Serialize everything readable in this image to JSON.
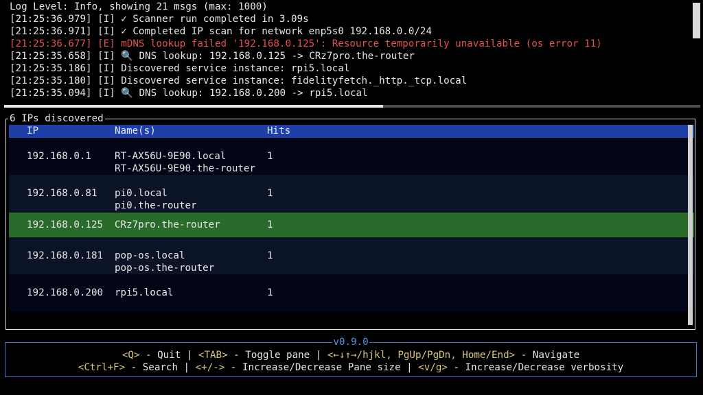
{
  "log": {
    "header": "Log Level: Info, showing 21 msgs (max: 1000)",
    "lines": [
      {
        "text": "[21:25:36.979] [I] ✓ Scanner run completed in 3.09s",
        "level": "info"
      },
      {
        "text": "[21:25:36.971] [I] ✓ Completed IP scan for network enp5s0 192.168.0.0/24",
        "level": "info"
      },
      {
        "text": "[21:25:36.677] [E] mDNS lookup failed '192.168.0.125': Resource temporarily unavailable (os error 11)",
        "level": "error"
      },
      {
        "text": "[21:25:35.658] [I] 🔍 DNS lookup: 192.168.0.125 -> CRz7pro.the-router",
        "level": "info"
      },
      {
        "text": "[21:25:35.186] [I] Discovered service instance: rpi5.local",
        "level": "info"
      },
      {
        "text": "[21:25:35.180] [I] Discovered service instance: fidelityfetch._http._tcp.local",
        "level": "info"
      },
      {
        "text": "[21:25:35.094] [I] 🔍 DNS lookup: 192.168.0.200 -> rpi5.local",
        "level": "info"
      }
    ],
    "colors": {
      "info": "#e6e6e6",
      "error": "#e0514f"
    }
  },
  "ip_table": {
    "title": "6 IPs discovered",
    "columns": {
      "ip": "IP",
      "names": "Name(s)",
      "hits": "Hits"
    },
    "rows": [
      {
        "ip": "192.168.0.1",
        "names": [
          "RT-AX56U-9E90.local",
          "RT-AX56U-9E90.the-router"
        ],
        "hits": "1",
        "selected": false
      },
      {
        "ip": "192.168.0.81",
        "names": [
          "pi0.local",
          "pi0.the-router"
        ],
        "hits": "1",
        "selected": false
      },
      {
        "ip": "192.168.0.125",
        "names": [
          "CRz7pro.the-router"
        ],
        "hits": "1",
        "selected": true
      },
      {
        "ip": "192.168.0.181",
        "names": [
          "pop-os.local",
          "pop-os.the-router"
        ],
        "hits": "1",
        "selected": false
      },
      {
        "ip": "192.168.0.200",
        "names": [
          "rpi5.local"
        ],
        "hits": "1",
        "selected": false
      }
    ],
    "colors": {
      "header_bg": "#1e3fa8",
      "selected_bg": "#2a6b2c",
      "row_a": "#020616",
      "row_b": "#0b1426"
    }
  },
  "help": {
    "version": "v0.9.0",
    "line1": [
      {
        "key": "<Q>",
        "desc": " - Quit "
      },
      {
        "sep": "| "
      },
      {
        "key": "<TAB>",
        "desc": " - Toggle pane "
      },
      {
        "sep": "| "
      },
      {
        "key": "<←↓↑→/hjkl, PgUp/PgDn, Home/End>",
        "desc": " - Navigate"
      }
    ],
    "line2": [
      {
        "key": "<Ctrl+F>",
        "desc": " - Search "
      },
      {
        "sep": "| "
      },
      {
        "key": "<+/->",
        "desc": " - Increase/Decrease Pane size "
      },
      {
        "sep": "| "
      },
      {
        "key": "<v/g>",
        "desc": " - Increase/Decrease verbosity"
      }
    ],
    "colors": {
      "key": "#d8c77a",
      "border": "#3b76d6",
      "version": "#5d93e6"
    }
  }
}
